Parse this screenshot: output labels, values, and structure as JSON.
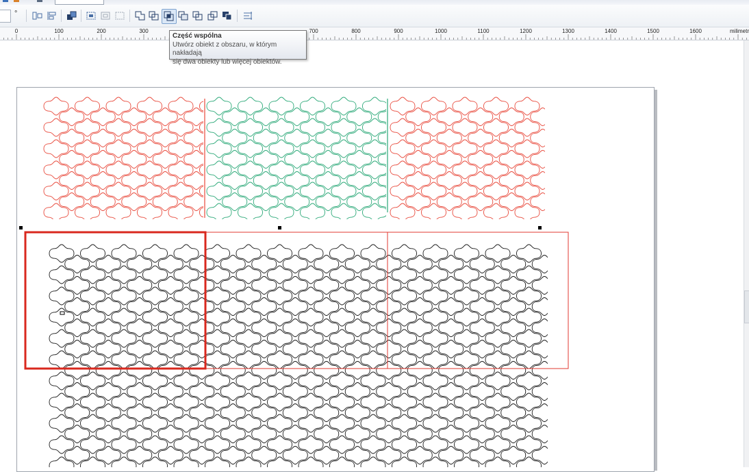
{
  "toolbar": {
    "angle_unit": "°",
    "icons": [
      "align-left-icon",
      "align-right-icon",
      "order-icon",
      "distribute-icon",
      "group-icon",
      "ungroup-icon",
      "weld-icon",
      "trim-icon",
      "intersect-icon",
      "simplify-icon",
      "front-minus-back-icon",
      "back-minus-front-icon",
      "boundary-icon",
      "align-distribute-icon"
    ],
    "active_icon": "intersect-icon"
  },
  "ruler": {
    "labels": [
      "0",
      "100",
      "200",
      "300",
      "700",
      "800",
      "900",
      "1000",
      "1100",
      "1200",
      "1300",
      "1400",
      "1500",
      "1600"
    ],
    "unit": "milimetry"
  },
  "tooltip": {
    "title": "Część wspólna",
    "line1": "Utwórz obiekt z obszaru, w którym nakładają",
    "line2": "się dwa obiekty lub więcej obiektów."
  },
  "colors": {
    "red_pattern": "#e8483a",
    "green_pattern": "#2aa877",
    "black_pattern": "#1a1a1a",
    "selection_red": "#d9281e",
    "frame_red": "#e03a30"
  }
}
